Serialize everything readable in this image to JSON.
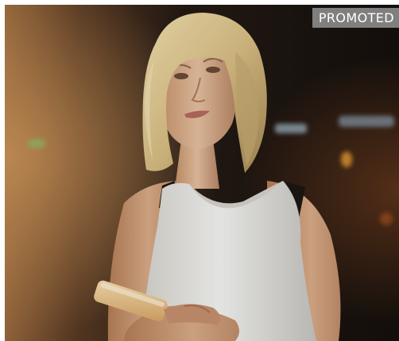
{
  "ad": {
    "badge_label": "PROMOTED"
  },
  "colors": {
    "badge_bg": "#7f7f7f",
    "badge_text": "#ffffff",
    "border": "#ffffff",
    "background_dark": "#1e1713",
    "warm_light": "#c98a4e",
    "shirt": "#f2f2ef",
    "hair": "#e3cd93",
    "skin": "#e2b996",
    "phone": "#f0ca8a"
  }
}
